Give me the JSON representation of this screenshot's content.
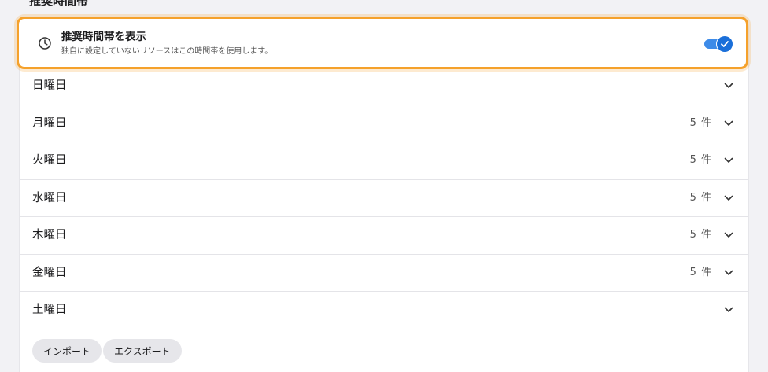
{
  "section": {
    "title": "推奨時間帯"
  },
  "setting": {
    "title": "推奨時間帯を表示",
    "description": "独自に設定していないリソースはこの時間帯を使用します。",
    "toggle_on": true,
    "accent_color": "#1a6fd9",
    "highlight_color": "#f5a12b",
    "icon": "clock-icon"
  },
  "days": [
    {
      "label": "日曜日",
      "count": ""
    },
    {
      "label": "月曜日",
      "count": "5 件"
    },
    {
      "label": "火曜日",
      "count": "5 件"
    },
    {
      "label": "水曜日",
      "count": "5 件"
    },
    {
      "label": "木曜日",
      "count": "5 件"
    },
    {
      "label": "金曜日",
      "count": "5 件"
    },
    {
      "label": "土曜日",
      "count": ""
    }
  ],
  "actions": {
    "import_label": "インポート",
    "export_label": "エクスポート"
  }
}
